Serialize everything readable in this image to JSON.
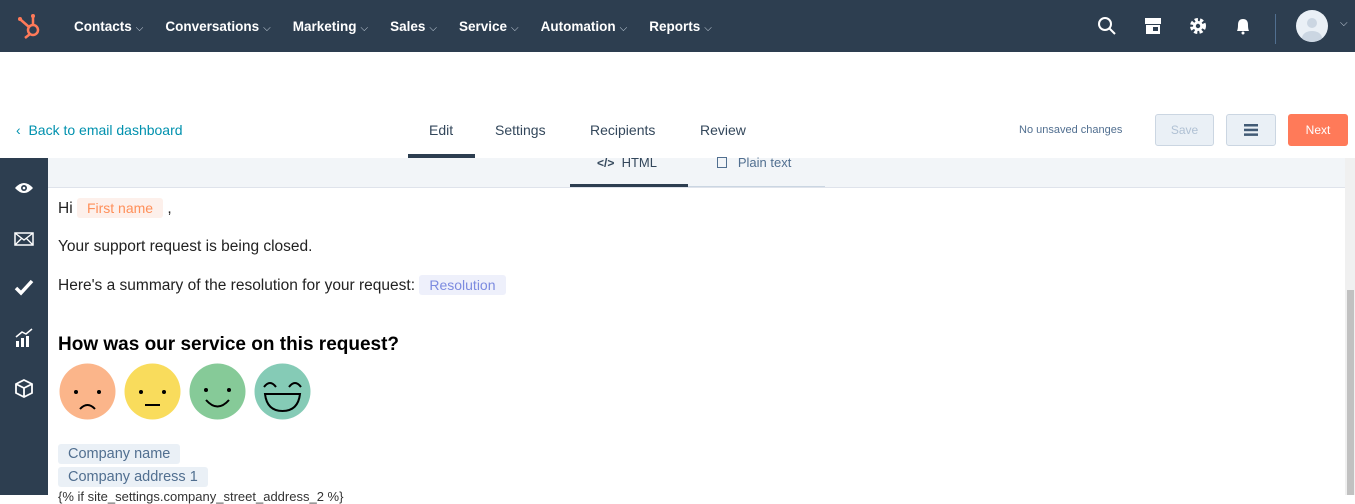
{
  "nav": {
    "items": [
      "Contacts",
      "Conversations",
      "Marketing",
      "Sales",
      "Service",
      "Automation",
      "Reports"
    ],
    "icons": [
      "search-icon",
      "marketplace-icon",
      "gear-icon",
      "bell-icon"
    ],
    "color": "#2d3e50"
  },
  "subheader": {
    "back": "Back to email dashboard",
    "tabs": [
      "Edit",
      "Settings",
      "Recipients",
      "Review"
    ],
    "active_tab": "Edit",
    "status": "No unsaved changes",
    "save": "Save",
    "next": "Next",
    "accent": "#ff7a59"
  },
  "sidebar": {
    "icons": [
      "eye-icon",
      "envelope-icon",
      "check-icon",
      "chart-icon",
      "cube-icon"
    ]
  },
  "mode_tabs": {
    "html": "HTML",
    "plain": "Plain text",
    "active": "HTML"
  },
  "email": {
    "greeting": "Hi",
    "first_name_token": "First name",
    "comma": ",",
    "line1": "Your support request is being closed.",
    "line2": "Here's a summary of the resolution for your request:",
    "resolution_token": "Resolution",
    "question": "How was our service on this request?",
    "faces": [
      "sad",
      "neutral",
      "happy",
      "very-happy"
    ],
    "company_name_token": "Company name",
    "company_address_token": "Company address 1",
    "template_line": "{% if site_settings.company_street_address_2 %}"
  }
}
